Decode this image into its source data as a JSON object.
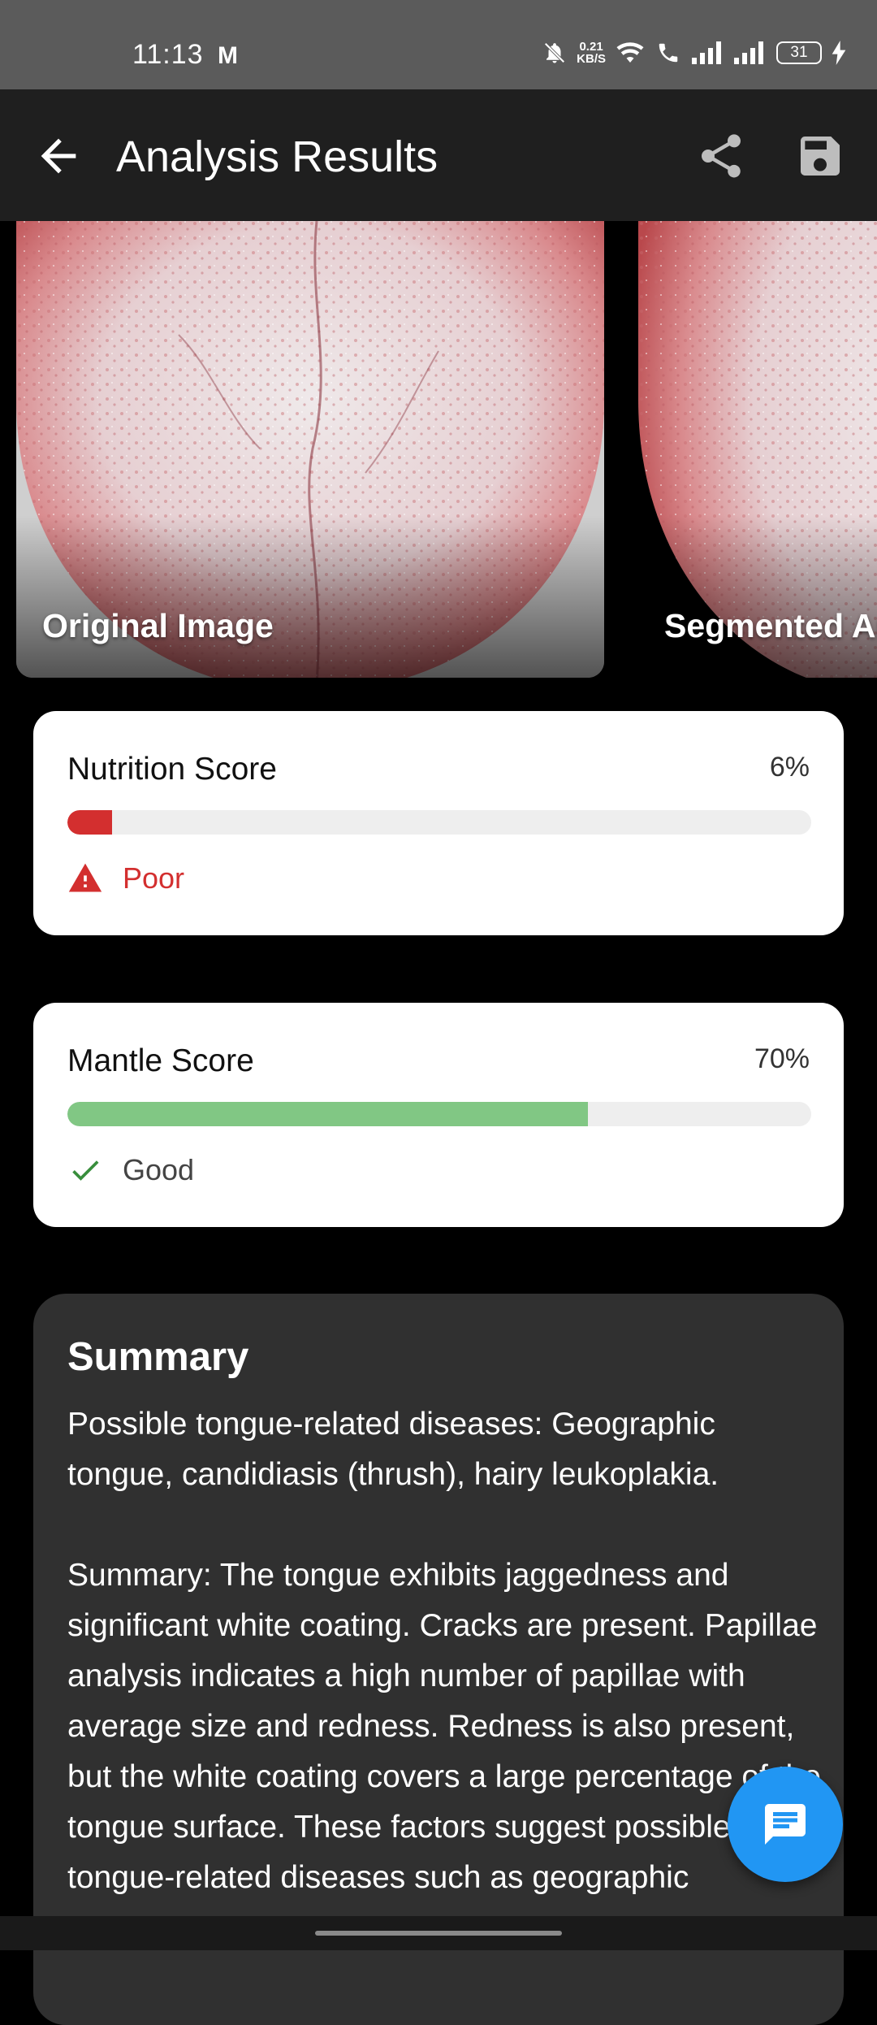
{
  "status_bar": {
    "time": "11:13",
    "notification_glyph": "M",
    "speed_value": "0.21",
    "speed_unit": "KB/S",
    "battery": "31",
    "icons": [
      "bell-off-icon",
      "wifi-icon",
      "call-icon",
      "signal-icon",
      "signal-icon",
      "battery-icon",
      "charging-icon"
    ]
  },
  "app_bar": {
    "title": "Analysis Results",
    "back_icon": "arrow-left-icon",
    "share_icon": "share-icon",
    "save_icon": "save-icon"
  },
  "images": [
    {
      "caption": "Original Image"
    },
    {
      "caption": "Segmented Ar"
    }
  ],
  "scores": [
    {
      "title": "Nutrition Score",
      "value_label": "6%",
      "value": 0.06,
      "status": "Poor",
      "status_icon": "warning-icon",
      "color": "#d32f2f",
      "status_color": "#d32f2f"
    },
    {
      "title": "Mantle Score",
      "value_label": "70%",
      "value": 0.7,
      "status": "Good",
      "status_icon": "check-icon",
      "color": "#81c784",
      "status_color": "#388e3c"
    }
  ],
  "summary": {
    "title": "Summary",
    "text": "Possible tongue-related diseases: Geographic tongue, candidiasis (thrush), hairy leukoplakia.\n\nSummary: The tongue exhibits jaggedness and significant white coating. Cracks are present. Papillae analysis indicates a high number of papillae with average size and redness. Redness is also present, but the white coating covers a large percentage of the tongue surface. These factors suggest possible tongue-related diseases such as geographic"
  },
  "fab": {
    "icon": "chat-icon"
  },
  "colors": {
    "app_bar": "#1f1f1f",
    "background": "#000000",
    "fab": "#2196f3",
    "summary_card": "#303030"
  }
}
